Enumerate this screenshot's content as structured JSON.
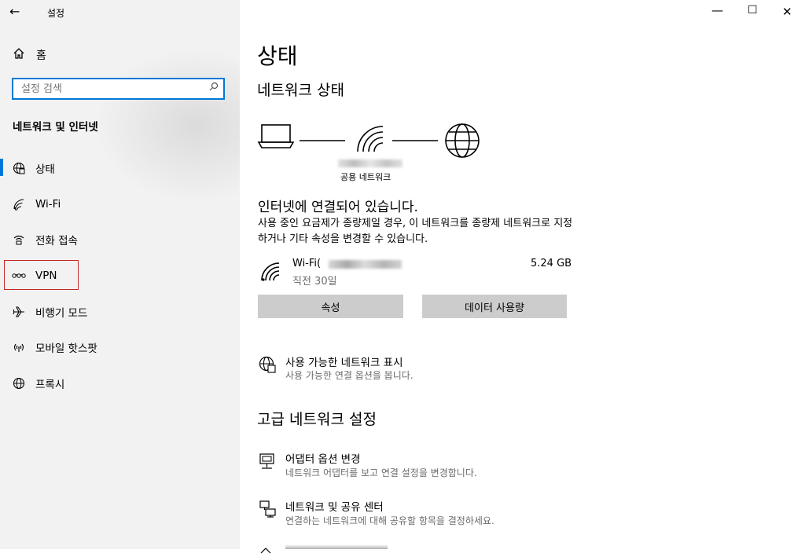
{
  "app": {
    "title": "설정",
    "back_icon": "back-arrow-icon"
  },
  "window_controls": {
    "minimize": "—",
    "maximize": "☐",
    "close": "✕"
  },
  "sidebar": {
    "home_label": "홈",
    "search_placeholder": "설정 검색",
    "section_title": "네트워크 및 인터넷",
    "items": [
      {
        "label": "상태",
        "icon": "globe-status-icon",
        "selected": true
      },
      {
        "label": "Wi-Fi",
        "icon": "wifi-icon"
      },
      {
        "label": "전화 접속",
        "icon": "dialup-icon"
      },
      {
        "label": "VPN",
        "icon": "vpn-icon",
        "highlighted": true
      },
      {
        "label": "비행기 모드",
        "icon": "airplane-icon"
      },
      {
        "label": "모바일 핫스팟",
        "icon": "hotspot-icon"
      },
      {
        "label": "프록시",
        "icon": "globe-icon"
      }
    ]
  },
  "main": {
    "title": "상태",
    "network_status_heading": "네트워크 상태",
    "network_type": "공용 네트워크",
    "connected_text": "인터넷에 연결되어 있습니다.",
    "description": "사용 중인 요금제가 종량제일 경우, 이 네트워크를 종량제 네트워크로 지정하거나 기타 속성을 변경할 수 있습니다.",
    "connection": {
      "name_prefix": "Wi-Fi(",
      "period": "직전 30일",
      "usage": "5.24 GB"
    },
    "buttons": {
      "properties": "속성",
      "data_usage": "데이터 사용량"
    },
    "show_networks": {
      "title": "사용 가능한 네트워크 표시",
      "subtitle": "사용 가능한 연결 옵션을 봅니다."
    },
    "advanced_heading": "고급 네트워크 설정",
    "adapter": {
      "title": "어댑터 옵션 변경",
      "subtitle": "네트워크 어댑터를 보고 연결 설정을 변경합니다."
    },
    "sharing": {
      "title": "네트워크 및 공유 센터",
      "subtitle": "연결하는 네트워크에 대해 공유할 항목을 결정하세요."
    }
  },
  "colors": {
    "accent": "#0078d7",
    "sidebar_bg": "#f2f2f2",
    "highlight_box": "#c62828",
    "button_bg": "#cccccc"
  }
}
